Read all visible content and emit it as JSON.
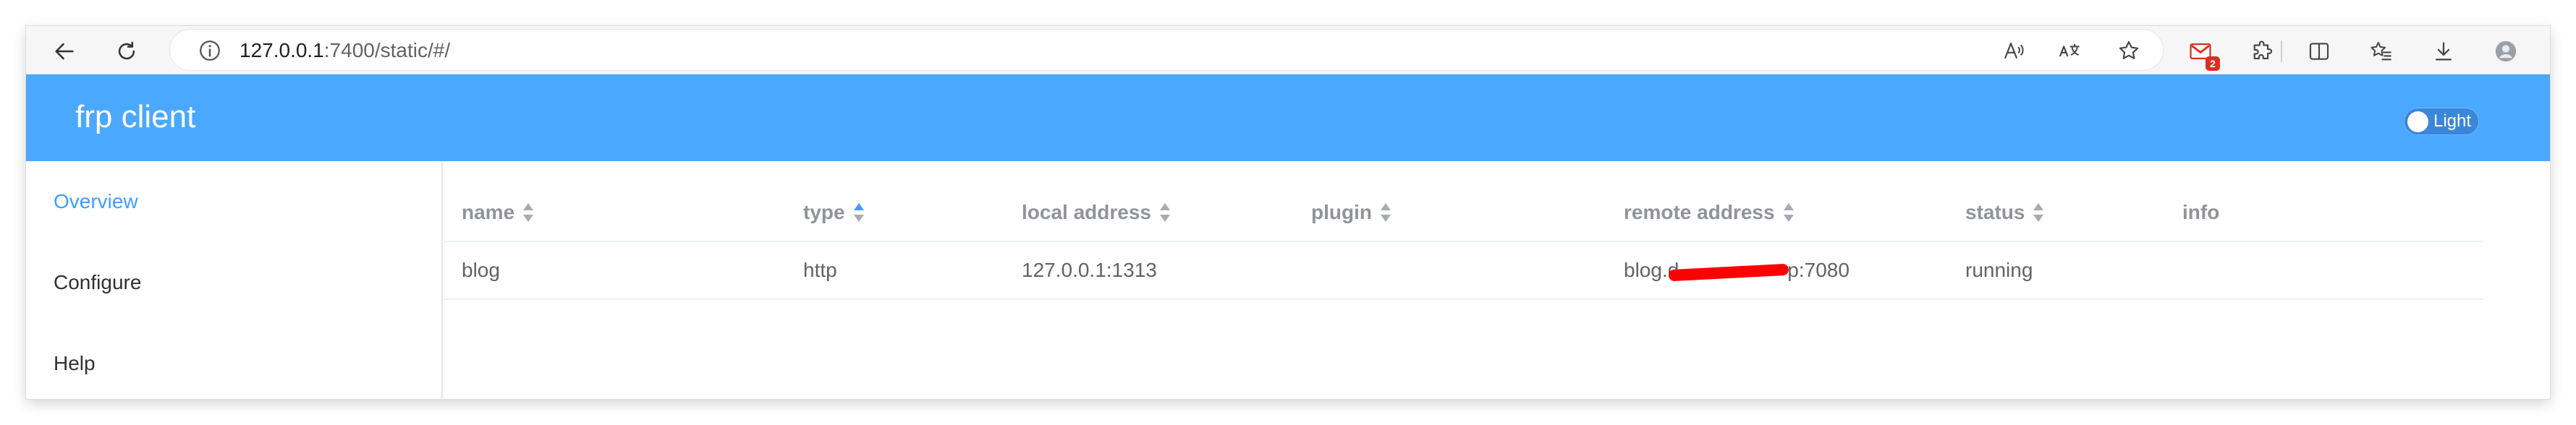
{
  "browser": {
    "url_host": "127.0.0.1",
    "url_rest": ":7400/static/#/",
    "icons": [
      "back-arrow-icon",
      "refresh-icon",
      "info-icon",
      "read-aloud-icon",
      "translate-icon",
      "favorite-star-icon",
      "gmail-extension-icon",
      "extensions-puzzle-icon",
      "split-screen-icon",
      "favorites-list-icon",
      "download-icon",
      "profile-avatar-icon"
    ],
    "gmail_badge": "2"
  },
  "app": {
    "title": "frp client",
    "theme_label": "Light",
    "header_color": "#4ba8ff",
    "accent_color": "#409eff"
  },
  "sidebar": {
    "items": [
      {
        "label": "Overview",
        "active": true
      },
      {
        "label": "Configure",
        "active": false
      },
      {
        "label": "Help",
        "active": false
      }
    ]
  },
  "table": {
    "columns": [
      "name",
      "type",
      "local address",
      "plugin",
      "remote address",
      "status",
      "info"
    ],
    "sorted_column": "type",
    "rows": [
      {
        "name": "blog",
        "type": "http",
        "local_address": "127.0.0.1:1313",
        "plugin": "",
        "remote_address_start": "blog.d",
        "remote_address_end": "p:7080",
        "status": "running",
        "info": ""
      }
    ]
  }
}
